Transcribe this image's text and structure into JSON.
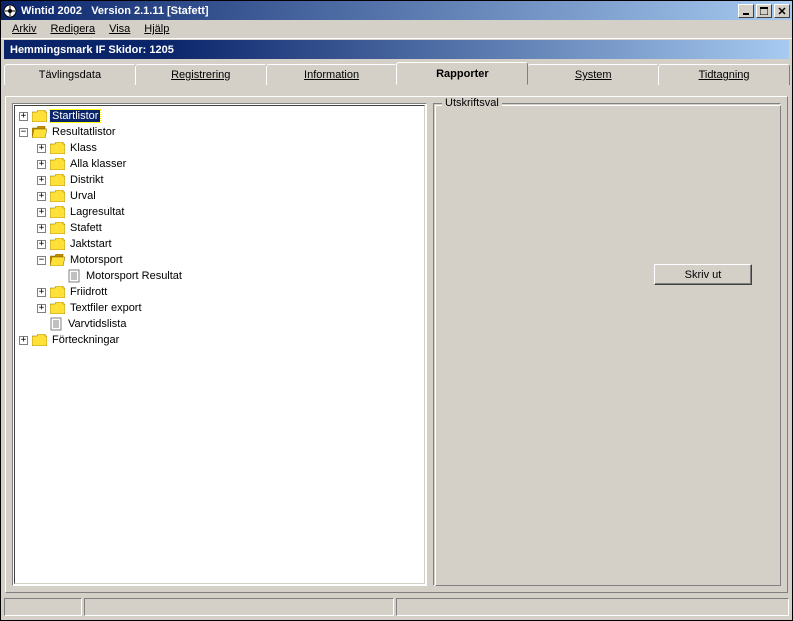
{
  "title": "Wintid 2002   Version 2.1.11 [Stafett]",
  "menus": {
    "arkiv": "Arkiv",
    "redigera": "Redigera",
    "visa": "Visa",
    "hjalp": "Hjälp"
  },
  "subtitle": "Hemmingsmark IF Skidor: 1205",
  "tabs": {
    "tavlingsdata": "Tävlingsdata",
    "registrering": "Registrering",
    "information": "Information",
    "rapporter": "Rapporter",
    "system": "System",
    "tidtagning": "Tidtagning"
  },
  "tree": {
    "startlistor": "Startlistor",
    "resultatlistor": "Resultatlistor",
    "klass": "Klass",
    "alla_klasser": "Alla klasser",
    "distrikt": "Distrikt",
    "urval": "Urval",
    "lagresultat": "Lagresultat",
    "stafett": "Stafett",
    "jaktstart": "Jaktstart",
    "motorsport": "Motorsport",
    "motorsport_resultat": "Motorsport Resultat",
    "friidrott": "Friidrott",
    "textfiler_export": "Textfiler export",
    "varvtidslista": "Varvtidslista",
    "forteckningar": "Förteckningar"
  },
  "groupbox": {
    "title": "Utskriftsval"
  },
  "buttons": {
    "skriv_ut": "Skriv ut"
  },
  "expand": {
    "plus": "+",
    "minus": "−"
  }
}
